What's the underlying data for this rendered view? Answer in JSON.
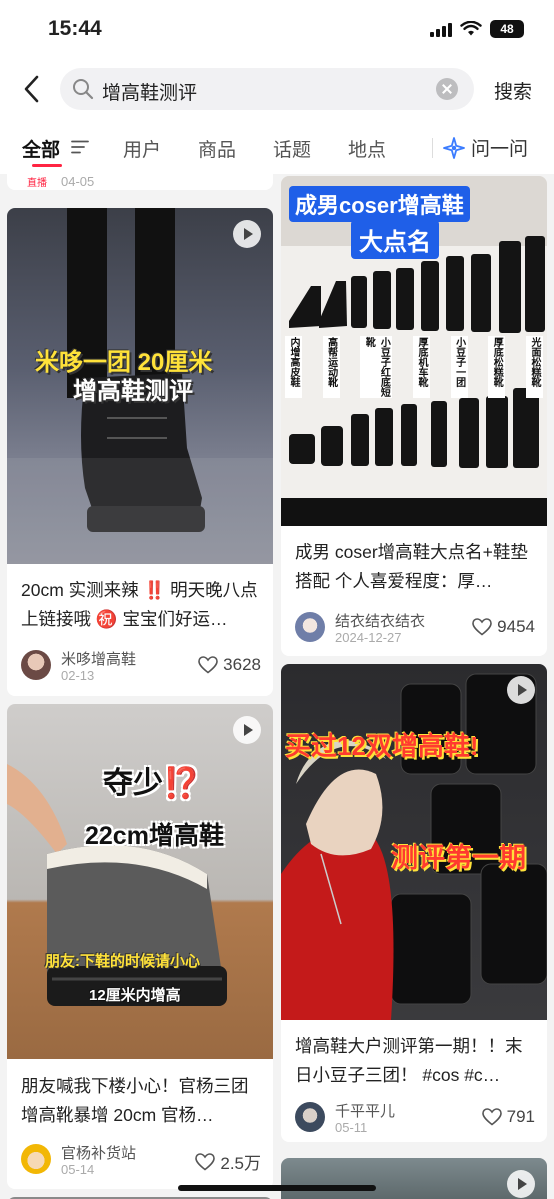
{
  "status": {
    "time": "15:44",
    "battery": "48"
  },
  "search": {
    "query": "增高鞋测评",
    "submit": "搜索"
  },
  "tabs": [
    "全部",
    "用户",
    "商品",
    "话题",
    "地点"
  ],
  "ask": "问一问",
  "top_partial": {
    "badge": "直播",
    "date": "04-05"
  },
  "cards": [
    {
      "overlay_1": "米哆一团 20厘米",
      "overlay_2": "增高鞋测评",
      "title": "20cm 实测来辣 ‼️ 明天晚八点上链接哦 ㊗️ 宝宝们好运…",
      "author": "米哆增高鞋",
      "date": "02-13",
      "likes": "3628"
    },
    {
      "overlay_1": "成男coser增高鞋",
      "overlay_2": "大点名",
      "labels": [
        "内增高皮鞋",
        "高帮运动靴",
        "小豆子红底短靴",
        "厚底机车靴",
        "小豆子一团",
        "厚底松糕靴",
        "光面松糕靴"
      ],
      "title": "成男 coser增高鞋大点名+鞋垫搭配 个人喜爱程度：厚…",
      "author": "结衣结衣结衣",
      "date": "2024-12-27",
      "likes": "9454"
    },
    {
      "overlay_1": "夺少⁉️",
      "overlay_2": "22cm增高鞋",
      "overlay_3": "朋友:下鞋的时候请小心",
      "overlay_4": "12厘米内增高",
      "title": "朋友喊我下楼小心！官杨三团增高靴暴增 20cm 官杨…",
      "author": "官杨补货站",
      "date": "05-14",
      "likes": "2.5万"
    },
    {
      "overlay_1": "买过12双增高鞋!",
      "overlay_2": "测评第一期",
      "title": "增高鞋大户测评第一期！！末日小豆子三团！ #cos #c…",
      "author": "千平平儿",
      "date": "05-11",
      "likes": "791"
    }
  ],
  "colors": {
    "accent": "#ff2442",
    "overlay_yellow": "#ffe23a",
    "overlay_red": "#ff3b2f"
  }
}
